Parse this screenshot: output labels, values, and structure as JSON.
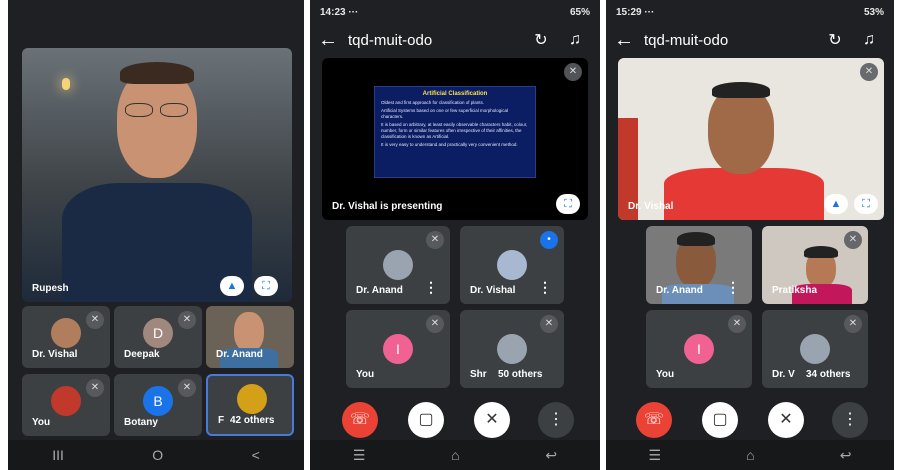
{
  "screen1": {
    "main": {
      "name": "Rupesh"
    },
    "tiles": [
      {
        "name": "Dr. Vishal",
        "kind": "avatar-photo"
      },
      {
        "name": "Deepak",
        "kind": "letter",
        "letter": "D",
        "color": "#a1887f"
      },
      {
        "name": "Dr. Anand",
        "kind": "video"
      },
      {
        "name": "You",
        "kind": "avatar-photo"
      },
      {
        "name": "Botany",
        "kind": "letter",
        "letter": "B",
        "color": "#1a73e8"
      },
      {
        "name": "F",
        "kind": "others",
        "others": "42 others"
      }
    ],
    "nav": [
      "III",
      "O",
      "<"
    ]
  },
  "screen2": {
    "status": {
      "time": "14:23 ···",
      "battery": "65%"
    },
    "title": "tqd-muit-odo",
    "presenting": "Dr. Vishal is presenting",
    "slide": {
      "title": "Artificial Classification",
      "bullets": [
        "Oldest and first approach for classification of plants.",
        "Artificial Systems based on one or few superficial morphological characters.",
        "It is based on arbitrary, at least easily observable characters habit, colour, number, form or similar features often irrespective of their affinities, the classification is known as Artificial.",
        "It is very easy to understand and practically very convenient method."
      ]
    },
    "tiles": [
      {
        "name": "Dr. Anand"
      },
      {
        "name": "Dr. Vishal"
      },
      {
        "name": "You",
        "letter": "I"
      },
      {
        "name": "Shr",
        "others": "50 others"
      }
    ]
  },
  "screen3": {
    "status": {
      "time": "15:29 ···",
      "battery": "53%"
    },
    "title": "tqd-muit-odo",
    "main": {
      "name": "Dr. Vishal"
    },
    "tiles": [
      {
        "name": "Dr. Anand"
      },
      {
        "name": "Pratiksha"
      },
      {
        "name": "You",
        "letter": "I"
      },
      {
        "name": "Dr. V",
        "others": "34 others"
      }
    ]
  },
  "colors": {
    "end_call": "#ea4335",
    "accent": "#1a73e8",
    "you_avatar": "#f06292"
  }
}
